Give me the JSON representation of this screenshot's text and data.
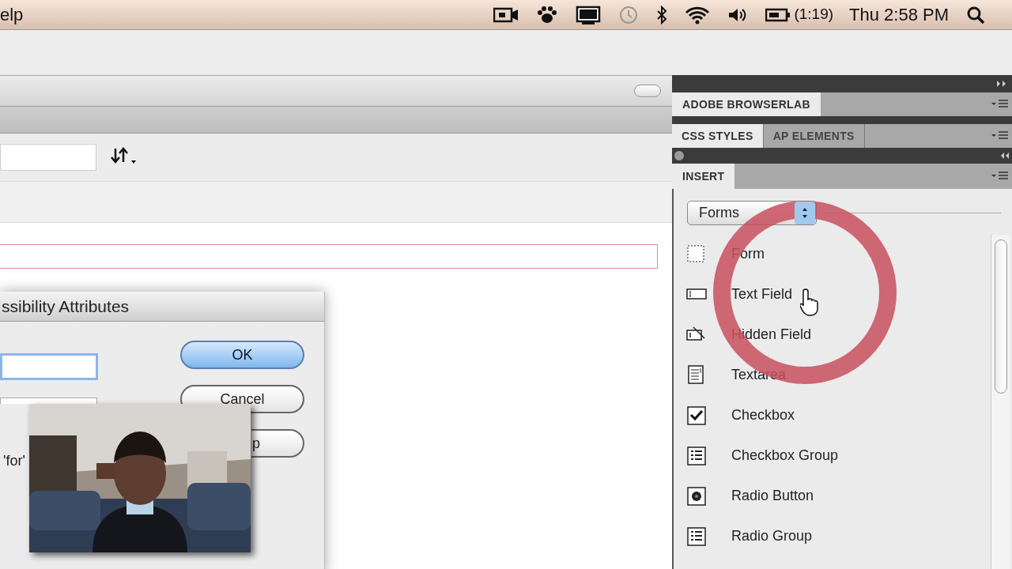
{
  "menu_bar": {
    "menu": "elp",
    "battery_time": "(1:19)",
    "clock": "Thu 2:58 PM"
  },
  "document_window": {
    "dialog": {
      "title": "ssibility Attributes",
      "label_fragment": "'for'",
      "buttons": [
        {
          "label": "OK",
          "default": true
        },
        {
          "label": "Cancel",
          "default": false
        },
        {
          "label": "p",
          "default": false
        }
      ]
    }
  },
  "panels": {
    "browserlab_tab": "ADOBE BROWSERLAB",
    "tabs": [
      {
        "label": "CSS STYLES",
        "selected": true
      },
      {
        "label": "AP ELEMENTS",
        "selected": false
      }
    ],
    "insert_tab": "INSERT",
    "category": "Forms",
    "items": [
      {
        "label": "Form",
        "kind": "form"
      },
      {
        "label": "Text Field",
        "kind": "textfield"
      },
      {
        "label": "Hidden Field",
        "kind": "hidden"
      },
      {
        "label": "Textarea",
        "kind": "textarea"
      },
      {
        "label": "Checkbox",
        "kind": "checkbox"
      },
      {
        "label": "Checkbox Group",
        "kind": "group"
      },
      {
        "label": "Radio Button",
        "kind": "radio"
      },
      {
        "label": "Radio Group",
        "kind": "group"
      }
    ]
  }
}
